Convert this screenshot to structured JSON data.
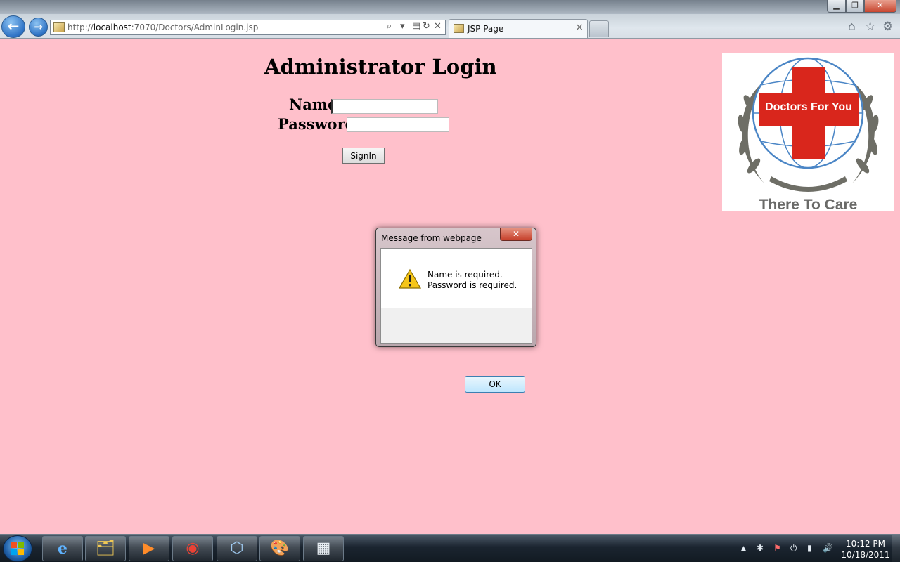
{
  "browser": {
    "url_prefix": "http://",
    "url_host": "localhost",
    "url_rest": ":7070/Doctors/AdminLogin.jsp",
    "tab_title": "JSP Page",
    "tab_close": "×",
    "nav_back": "←",
    "nav_forward": "→",
    "window_minimize": "▁",
    "window_maximize": "❐",
    "window_close": "✕",
    "addr_icons": [
      "search-icon",
      "dropdown-icon",
      "compat-view-icon",
      "refresh-icon",
      "stop-icon"
    ],
    "addr_glyphs": [
      "⌕",
      "▾",
      "▤",
      "↻",
      "✕"
    ],
    "toolbar_icons": [
      "home-icon",
      "favorites-star-icon",
      "tools-gear-icon"
    ],
    "toolbar_glyphs": [
      "⌂",
      "☆",
      "⚙"
    ]
  },
  "page": {
    "heading": "Administrator Login",
    "name_label": "Name",
    "name_value": "",
    "password_label": "Password",
    "password_value": "",
    "signin_label": "SignIn",
    "logo": {
      "name": "Doctors For You",
      "tagline": "There To Care",
      "cross_color": "#d9261c",
      "wreath_color": "#6e6e66",
      "globe_color": "#4b86c6"
    }
  },
  "dialog": {
    "title": "Message from webpage",
    "close": "✕",
    "messages": [
      "Name is required.",
      "Password is required."
    ],
    "ok_label": "OK",
    "icon": "warning-icon"
  },
  "taskbar": {
    "items": [
      {
        "name": "internet-explorer-icon",
        "glyph": "e"
      },
      {
        "name": "file-explorer-icon",
        "glyph": "🗂"
      },
      {
        "name": "media-player-icon",
        "glyph": "▶"
      },
      {
        "name": "chrome-icon",
        "glyph": "◉"
      },
      {
        "name": "virtualbox-icon",
        "glyph": "⬡"
      },
      {
        "name": "paint-icon",
        "glyph": "🎨"
      },
      {
        "name": "window-app-icon",
        "glyph": "▦"
      }
    ],
    "tray": {
      "glyphs": [
        "▲",
        "✱",
        "⚑",
        "⏻",
        "▮",
        "🔊"
      ],
      "names": [
        "show-hidden-icons",
        "bluetooth-icon",
        "action-center-icon",
        "power-icon",
        "network-icon",
        "volume-icon"
      ]
    },
    "time": "10:12 PM",
    "date": "10/18/2011"
  }
}
